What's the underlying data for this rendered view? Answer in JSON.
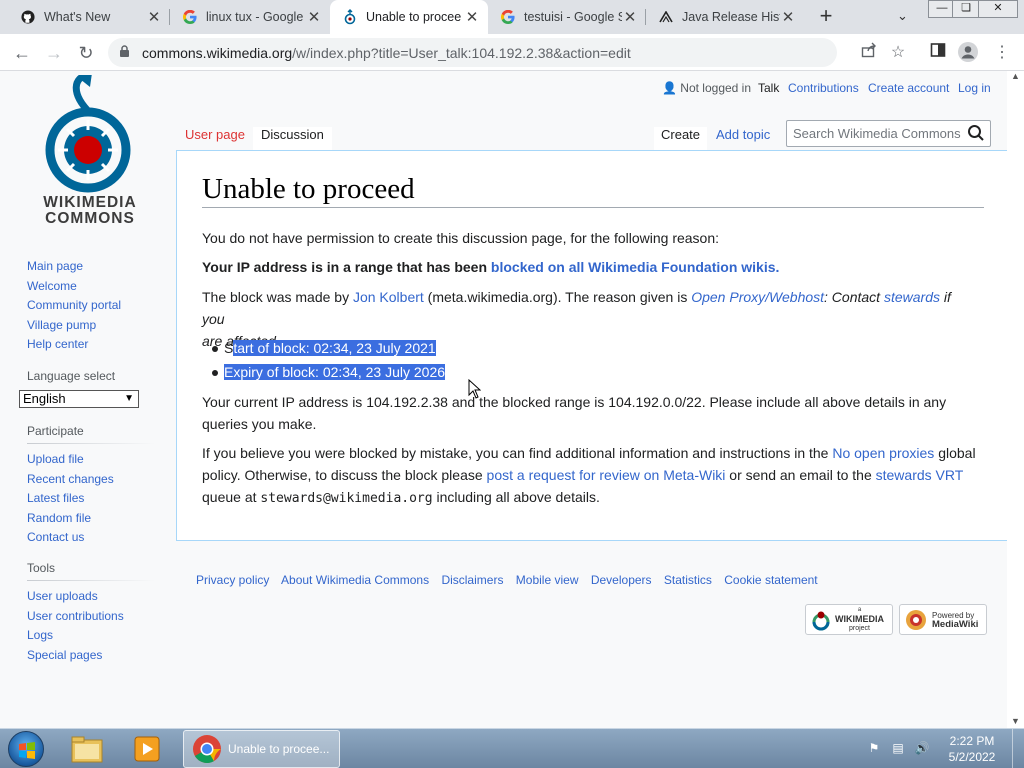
{
  "browser": {
    "tabs": [
      {
        "title": "What's New",
        "favicon": "github-icon"
      },
      {
        "title": "linux tux - Google",
        "favicon": "google-icon"
      },
      {
        "title": "Unable to procee",
        "favicon": "wikimedia-icon"
      },
      {
        "title": "testuisi - Google S",
        "favicon": "google-icon"
      },
      {
        "title": "Java Release Histo",
        "favicon": "wiki-icon"
      }
    ],
    "close_glyph": "✕",
    "new_tab_glyph": "+",
    "url_host": "commons.wikimedia.org",
    "url_path": "/w/index.php?title=User_talk:104.192.2.38&action=edit"
  },
  "personal": {
    "not_logged_in": "Not logged in",
    "talk": "Talk",
    "contributions": "Contributions",
    "create_account": "Create account",
    "log_in": "Log in"
  },
  "page_tabs": {
    "user_page": "User page",
    "discussion": "Discussion",
    "create": "Create",
    "add_topic": "Add topic"
  },
  "search": {
    "placeholder": "Search Wikimedia Commons"
  },
  "logo": {
    "line1": "WIKIMEDIA",
    "line2": "COMMONS"
  },
  "sidebar": {
    "nav": [
      "Main page",
      "Welcome",
      "Community portal",
      "Village pump",
      "Help center"
    ],
    "language_heading": "Language select",
    "language_value": "English",
    "participate_heading": "Participate",
    "participate": [
      "Upload file",
      "Recent changes",
      "Latest files",
      "Random file",
      "Contact us"
    ],
    "tools_heading": "Tools",
    "tools": [
      "User uploads",
      "User contributions",
      "Logs",
      "Special pages"
    ]
  },
  "content": {
    "title": "Unable to proceed",
    "p1": "You do not have permission to create this discussion page, for the following reason:",
    "p2_bold": "Your IP address is in a range that has been ",
    "p2_link": "blocked on all Wikimedia Foundation wikis.",
    "p3_a": "The block was made by ",
    "p3_link1": "Jon Kolbert",
    "p3_b": " (meta.wikimedia.org). The reason given is ",
    "p3_link2": "Open Proxy/Webhost",
    "p3_c": ": Contact ",
    "p3_link3": "stewards",
    "p3_d": " if you",
    "p3_e": "are affected.",
    "p3_f": " .",
    "li1_pre": "S",
    "li1_sel": "tart of block: 02:34, 23 July 2021",
    "li2": "Expiry of block: 02:34, 23 July 2026",
    "p4_line1": "Your current IP address is 104.192.2.38 and the blocked range is 104.192.0.0/22. Please include all above details in any",
    "p4_line2": "queries you make.",
    "p5_a": "If you believe you were blocked by mistake, you can find additional information and instructions in the ",
    "p5_link1": "No open proxies",
    "p5_b": " global",
    "p5_c": "policy. Otherwise, to discuss the block please ",
    "p5_link2": "post a request for review on Meta-Wiki",
    "p5_d": " or send an email to the ",
    "p5_link3": "stewards VRT",
    "p5_e": "queue at ",
    "p5_email": "stewards@wikimedia.org",
    "p5_f": " including all above details."
  },
  "footer": {
    "links": [
      "Privacy policy",
      "About Wikimedia Commons",
      "Disclaimers",
      "Mobile view",
      "Developers",
      "Statistics",
      "Cookie statement"
    ],
    "badge1_small": "a",
    "badge1_big": "WIKIMEDIA",
    "badge1_sub": "project",
    "badge2_small": "Powered by",
    "badge2_big": "MediaWiki"
  },
  "taskbar": {
    "active_window": "Unable to procee...",
    "time": "2:22 PM",
    "date": "5/2/2022"
  }
}
